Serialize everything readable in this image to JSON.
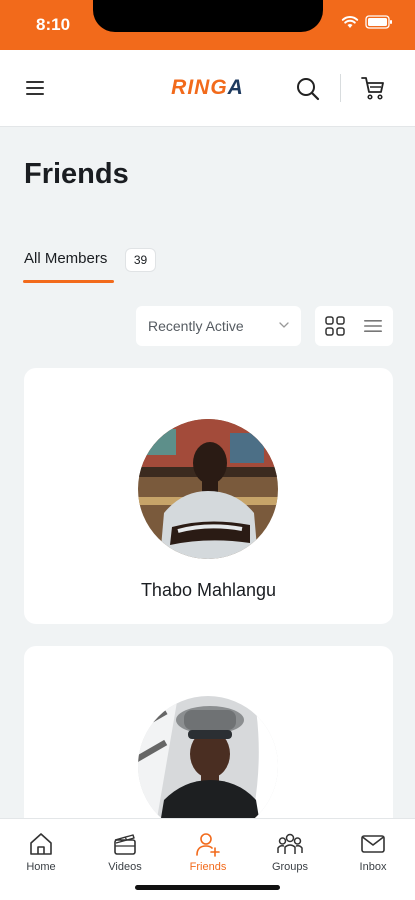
{
  "status_bar": {
    "time": "8:10",
    "icons": [
      "wifi-icon",
      "battery-icon"
    ]
  },
  "header": {
    "logo_main": "RING",
    "logo_accent": "A",
    "icons": [
      "menu-icon",
      "search-icon",
      "cart-icon"
    ]
  },
  "page": {
    "title": "Friends"
  },
  "tabs": [
    {
      "label": "All Members",
      "count": "39",
      "active": true
    }
  ],
  "filter": {
    "sort_label": "Recently Active",
    "views": [
      "grid-icon",
      "list-icon"
    ]
  },
  "members": [
    {
      "name": "Thabo Mahlangu"
    },
    {
      "name": ""
    }
  ],
  "bottom_nav": {
    "items": [
      {
        "label": "Home",
        "icon": "home-icon"
      },
      {
        "label": "Videos",
        "icon": "videos-icon"
      },
      {
        "label": "Friends",
        "icon": "add-friend-icon",
        "active": true
      },
      {
        "label": "Groups",
        "icon": "groups-icon"
      },
      {
        "label": "Inbox",
        "icon": "inbox-icon"
      }
    ]
  },
  "colors": {
    "accent": "#f26a1b",
    "background": "#f0f3f4",
    "card": "#ffffff",
    "text": "#1a1d21",
    "logo_accent": "#1e3a5f"
  }
}
